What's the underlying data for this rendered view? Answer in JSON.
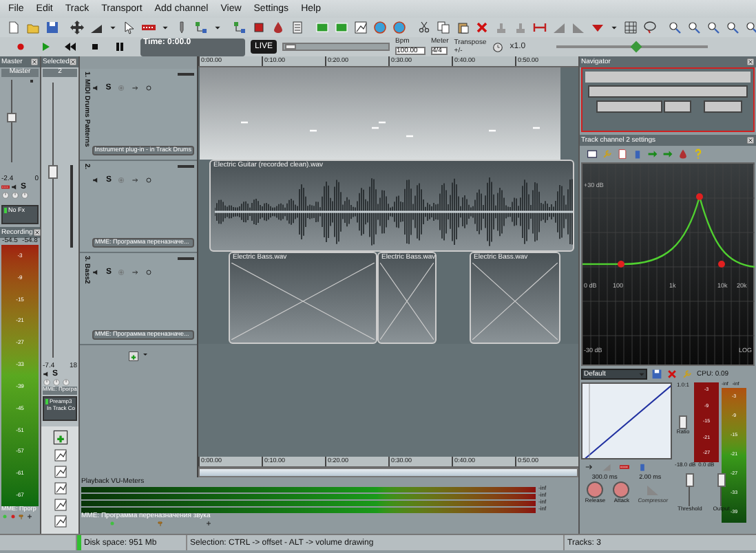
{
  "menu": [
    "File",
    "Edit",
    "Track",
    "Transport",
    "Add channel",
    "View",
    "Settings",
    "Help"
  ],
  "transport": {
    "time": "Time: 0:00.0",
    "live": "LIVE",
    "bpm_label": "Bpm",
    "bpm": "100.00",
    "meter_label": "Meter",
    "meter": "4/4",
    "transpose_label": "Transpose",
    "transpose": "+/-",
    "speed": "x1.0",
    "position": {
      "level": 0.02
    },
    "zoom": {
      "level": 0.55
    }
  },
  "ruler_top": [
    "0:00.00",
    "0:10.00",
    "0:20.00",
    "0:30.00",
    "0:40.00",
    "0:50.00"
  ],
  "ruler_bottom": [
    "0:00.00",
    "0:10.00",
    "0:20.00",
    "0:30.00",
    "0:40.00",
    "0:50.00"
  ],
  "master": {
    "title": "Master",
    "label": "Master",
    "volume": "-2.4",
    "pan": "0",
    "solo": "S",
    "fx": "No Fx"
  },
  "recording": {
    "title": "Recording",
    "peaks": [
      "-54.5",
      "-54.8"
    ],
    "scale": [
      "-3",
      "-9",
      "-15",
      "-21",
      "-27",
      "-33",
      "-39",
      "-45",
      "-51",
      "-57",
      "-61",
      "-67"
    ],
    "device": "MME: Прогр"
  },
  "selected": {
    "title": "Selected",
    "label": "2",
    "volume": "-7.4",
    "pan": "18",
    "solo": "S",
    "device": "MME: Програ",
    "fx": [
      "Preamp3",
      "In Track Co"
    ]
  },
  "tracks": [
    {
      "name": "1. MIDI Drums Patterns",
      "solo": "S",
      "device": "Instrument plug-in - in Track Drums",
      "clips": [
        {
          "kind": "midi"
        }
      ]
    },
    {
      "name": "2.",
      "solo": "S",
      "device": "MME: Программа переназначе...",
      "clips": [
        {
          "kind": "audio",
          "title": "Electric Guitar (recorded clean).wav"
        }
      ]
    },
    {
      "name": "3. Bass2",
      "solo": "S",
      "device": "MME: Программа переназначе...",
      "clips": [
        {
          "kind": "audio",
          "title": "Electric Bass.wav"
        },
        {
          "kind": "audio",
          "title": "Electric Bass.wav"
        },
        {
          "kind": "audio",
          "title": "Electric Bass.wav"
        }
      ]
    }
  ],
  "navigator": {
    "title": "Navigator"
  },
  "track_settings": {
    "title": "Track channel 2 settings",
    "eq_top": "+30 dB",
    "eq_zero": "0 dB",
    "eq_bottom": "-30 dB",
    "eq_scale": "LOG",
    "eq_freqs": [
      "100",
      "1k",
      "10k",
      "20k"
    ],
    "preset": "Default",
    "cpu": "CPU: 0.09",
    "ratio_value": "1.0:1",
    "ratio": "Ratio",
    "threshold_value": "-18.0 dB",
    "output_value": "0.0 dB",
    "release_value": "300.0 ms",
    "attack_value": "2.00 ms",
    "release": "Release",
    "attack": "Attack",
    "compressor": "Compressor",
    "threshold": "Threshold",
    "output": "Output",
    "meter_heads": [
      "-inf",
      "-inf"
    ],
    "reduction_scale": [
      "-3",
      "-9",
      "-15",
      "-21",
      "-27"
    ],
    "meter_scale": [
      "-3",
      "-9",
      "-15",
      "-21",
      "-27",
      "-33",
      "-39"
    ]
  },
  "vu": {
    "title": "Playback VU-Meters",
    "readings": [
      "-inf",
      "-inf",
      "-inf",
      "-inf"
    ],
    "device": "MME: Программа переназначения звука"
  },
  "status": {
    "disk": "Disk space: 951 Mb",
    "hint": "Selection: CTRL -> offset - ALT -> volume drawing",
    "tracks": "Tracks: 3"
  }
}
